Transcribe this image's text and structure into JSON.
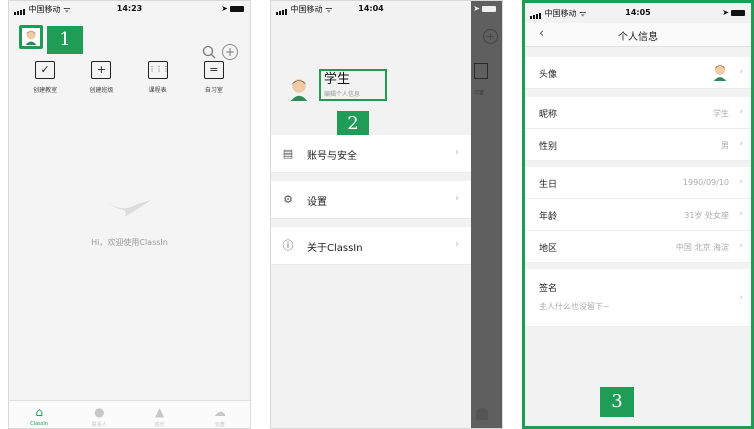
{
  "status_bar": {
    "carrier": "中国移动",
    "screen1_time": "14:23",
    "screen2_time": "14:04",
    "screen3_time": "14:05"
  },
  "screen1": {
    "callout": "1",
    "quick_actions": [
      {
        "label": "创建教室",
        "icon": "checkbox-icon"
      },
      {
        "label": "创建班级",
        "icon": "add-square-icon"
      },
      {
        "label": "课程表",
        "icon": "calendar-icon"
      },
      {
        "label": "自习室",
        "icon": "study-room-icon"
      }
    ],
    "welcome": "Hi，欢迎使用ClassIn",
    "tabs": [
      {
        "label": "ClassIn",
        "icon": "home-icon"
      },
      {
        "label": "联系人",
        "icon": "contacts-icon"
      },
      {
        "label": "成长",
        "icon": "tree-icon"
      },
      {
        "label": "云盘",
        "icon": "cloud-icon"
      }
    ]
  },
  "screen2": {
    "callout": "2",
    "profile": {
      "name": "学生",
      "subtitle": "编辑个人信息"
    },
    "menu": [
      {
        "label": "账号与安全",
        "icon": "id-card-icon"
      },
      {
        "label": "设置",
        "icon": "gear-icon"
      },
      {
        "label": "关于ClassIn",
        "icon": "info-icon"
      }
    ],
    "dim_label": "习室"
  },
  "screen3": {
    "callout": "3",
    "title": "个人信息",
    "rows": [
      {
        "label": "头像",
        "value": ""
      },
      {
        "label": "昵称",
        "value": "学生"
      },
      {
        "label": "性别",
        "value": "男"
      },
      {
        "label": "生日",
        "value": "1990/09/10"
      },
      {
        "label": "年龄",
        "value": "31岁 处女座"
      },
      {
        "label": "地区",
        "value": "中国 北京 海淀"
      }
    ],
    "signature": {
      "label": "签名",
      "value": "主人什么也没留下~"
    }
  },
  "colors": {
    "accent": "#1e9b54",
    "dim_overlay": "#5f5f5f"
  }
}
